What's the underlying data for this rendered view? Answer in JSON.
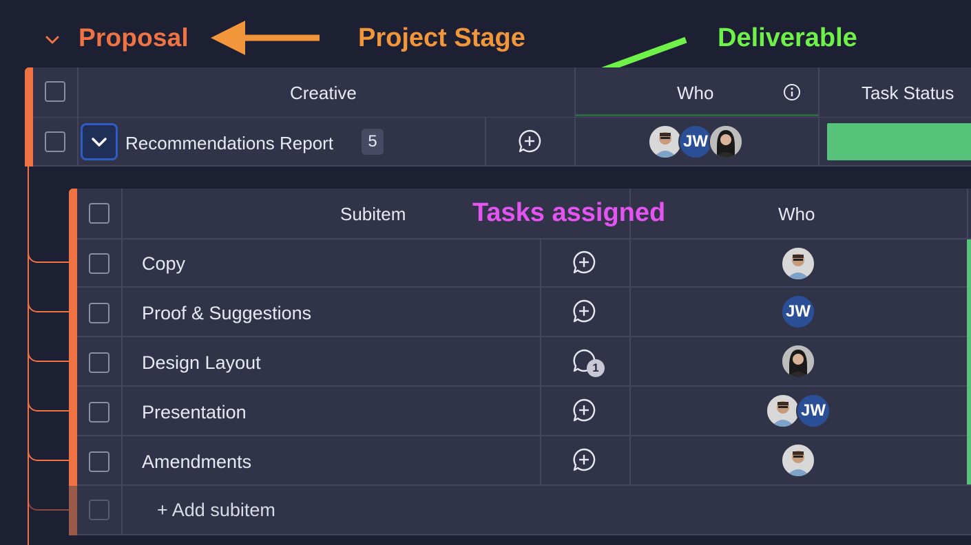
{
  "group": {
    "title": "Proposal",
    "color": "#f07344"
  },
  "annotations": {
    "project_stage": "Project Stage",
    "deliverable": "Deliverable",
    "tasks_assigned": "Tasks assigned"
  },
  "main_table": {
    "columns": {
      "creative": "Creative",
      "who": "Who",
      "task_status": "Task Status"
    },
    "item": {
      "name": "Recommendations Report",
      "subitem_count": "5",
      "assignees": [
        "person-1",
        "JW",
        "person-2"
      ],
      "status_color": "#57c27a"
    }
  },
  "sub_table": {
    "columns": {
      "subitem": "Subitem",
      "who": "Who"
    },
    "rows": [
      {
        "name": "Copy",
        "updates": "",
        "assignees": [
          "person-1"
        ]
      },
      {
        "name": "Proof & Suggestions",
        "updates": "",
        "assignees": [
          "JW"
        ]
      },
      {
        "name": "Design Layout",
        "updates": "1",
        "assignees": [
          "person-2"
        ]
      },
      {
        "name": "Presentation",
        "updates": "",
        "assignees": [
          "person-1",
          "JW"
        ]
      },
      {
        "name": "Amendments",
        "updates": "",
        "assignees": [
          "person-1"
        ]
      }
    ],
    "add_label": "+ Add subitem"
  },
  "avatar_initials": "JW"
}
